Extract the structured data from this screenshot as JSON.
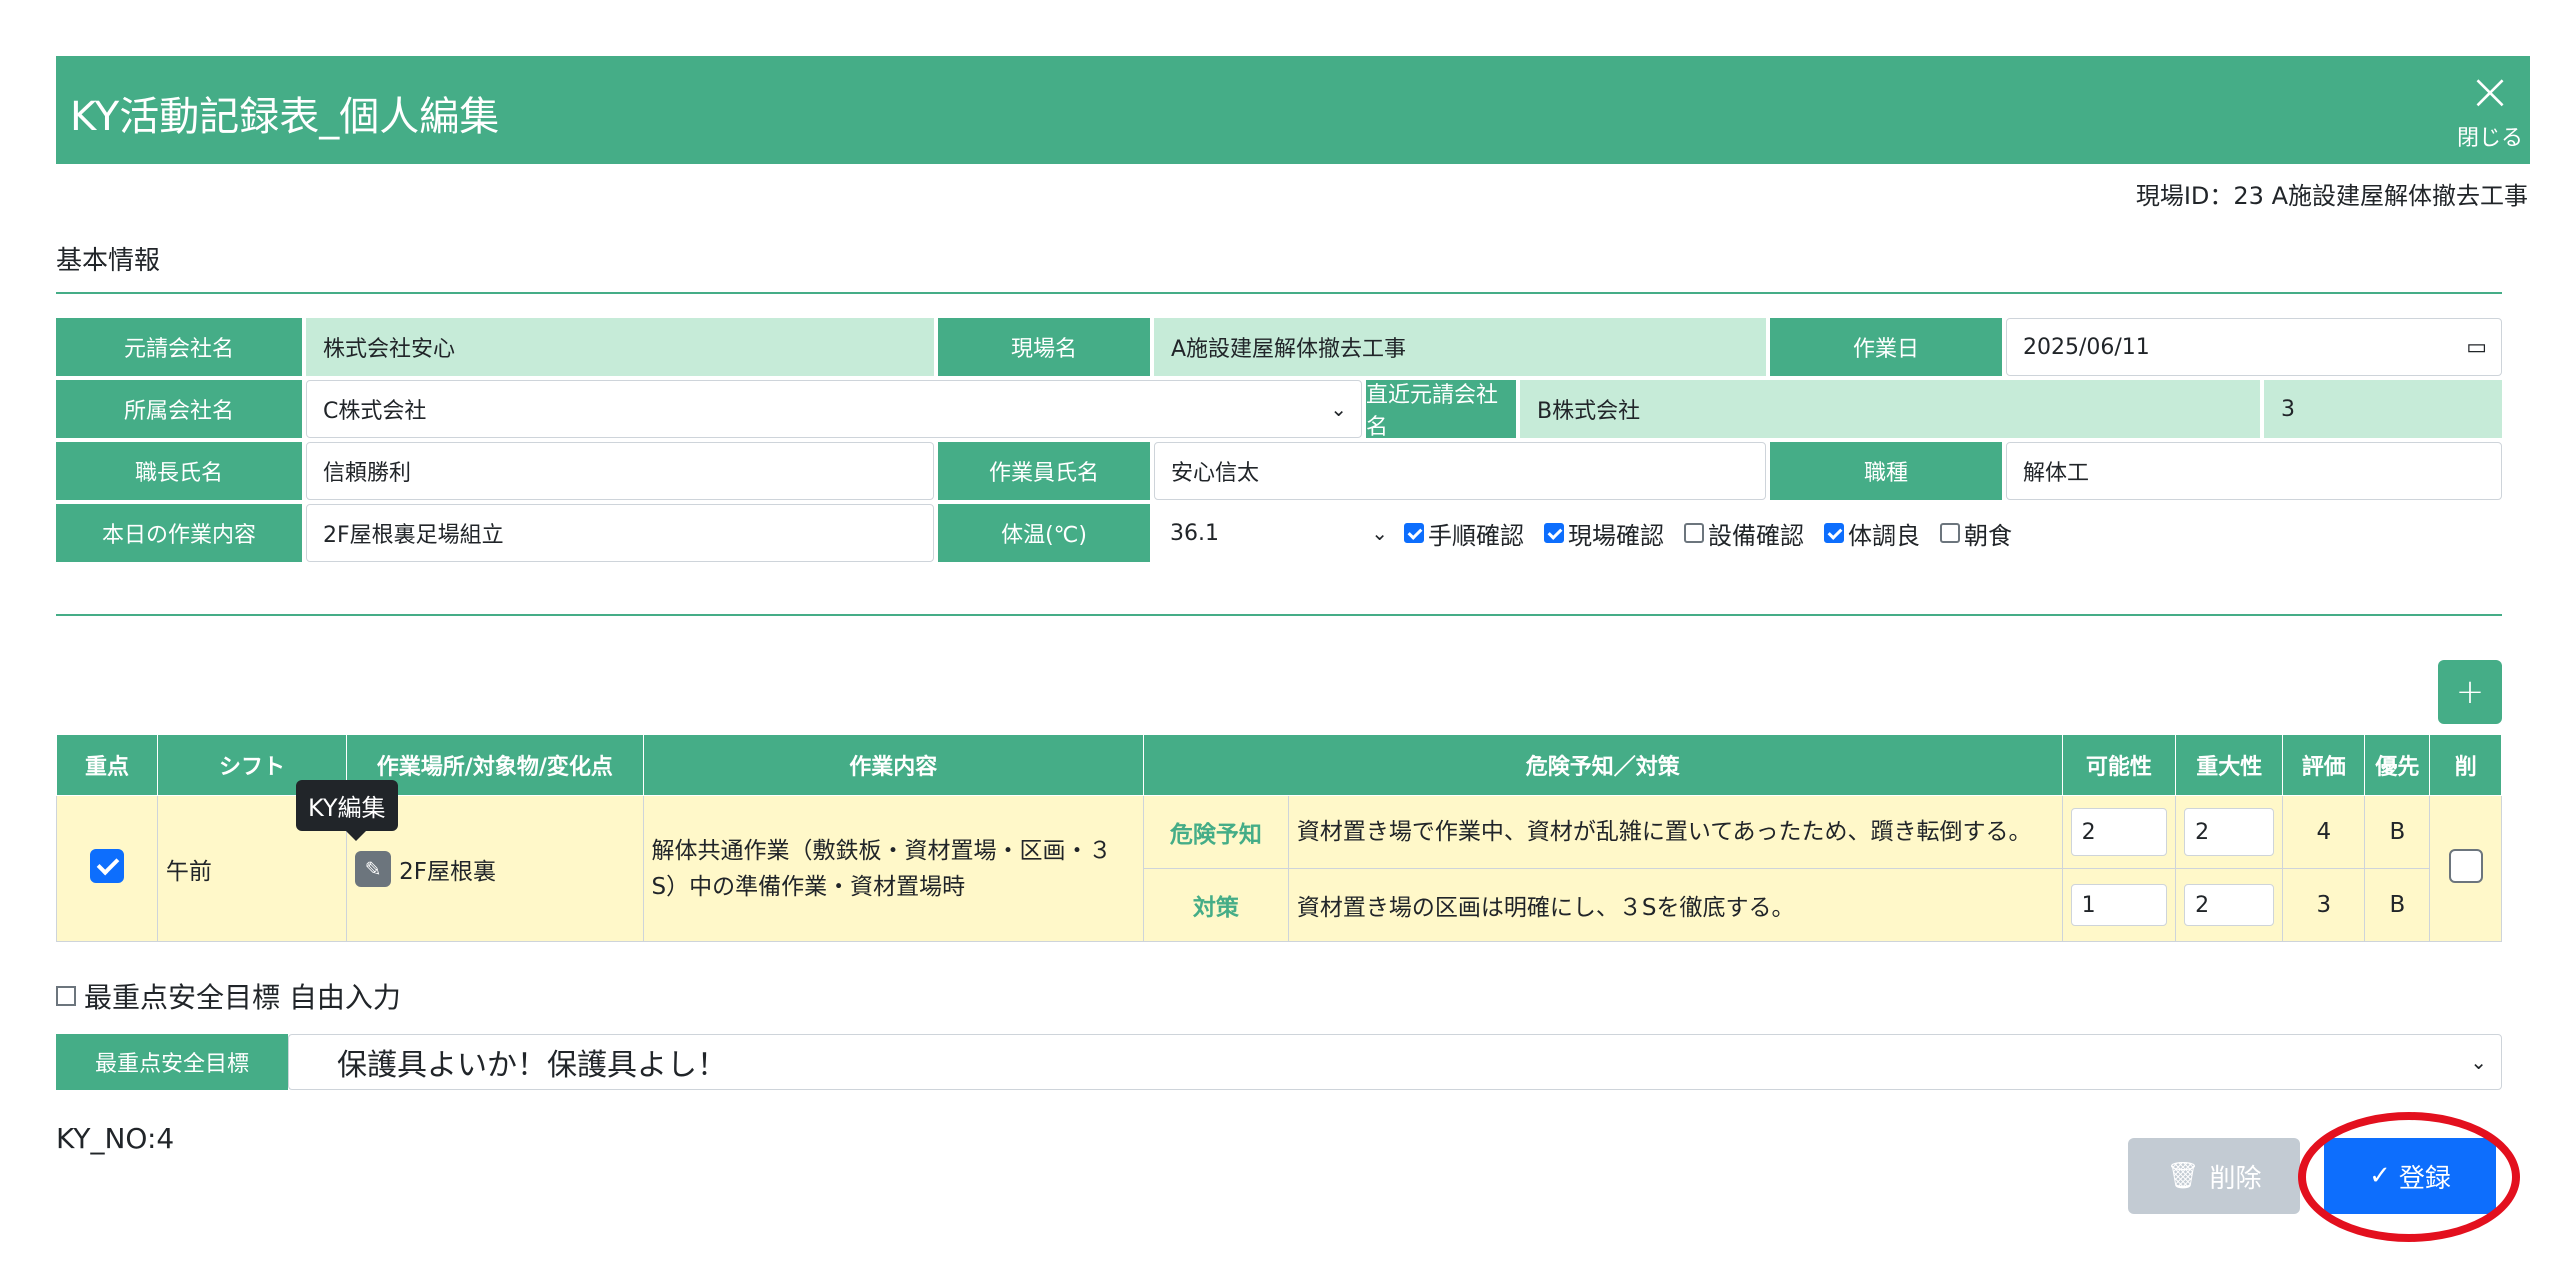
{
  "header": {
    "title": "KY活動記録表_個人編集",
    "close_label": "閉じる",
    "close_glyph": "×"
  },
  "site_id": "現場ID：23 A施設建屋解体撤去工事",
  "section": {
    "title": "基本情報"
  },
  "form": {
    "prime_company_label": "元請会社名",
    "prime_company_value": "株式会社安心",
    "site_name_label": "現場名",
    "site_name_value": "A施設建屋解体撤去工事",
    "work_date_label": "作業日",
    "work_date_value": "2025/06/11",
    "affiliation_label": "所属会社名",
    "affiliation_value": "C株式会社",
    "direct_prime_label": "直近元請会社名",
    "direct_prime_value": "B株式会社",
    "tier_value": "3",
    "foreman_label": "職長氏名",
    "foreman_value": "信頼勝利",
    "worker_label": "作業員氏名",
    "worker_value": "安心信太",
    "trade_label": "職種",
    "trade_value": "解体工",
    "today_work_label": "本日の作業内容",
    "today_work_value": "2F屋根裏足場組立",
    "temp_label": "体温(℃)",
    "temp_value": "36.1",
    "checks": [
      {
        "label": "手順確認",
        "checked": true
      },
      {
        "label": "現場確認",
        "checked": true
      },
      {
        "label": "設備確認",
        "checked": false
      },
      {
        "label": "体調良",
        "checked": true
      },
      {
        "label": "朝食",
        "checked": false
      }
    ]
  },
  "add_button": "+",
  "table": {
    "headers": [
      "重点",
      "シフト",
      "作業場所/対象物/変化点",
      "作業内容",
      "危険予知／対策",
      "可能性",
      "重大性",
      "評価",
      "優先",
      "削"
    ],
    "row": {
      "priority_checked": true,
      "shift": "午前",
      "location": "2F屋根裏",
      "work": "解体共通作業（敷鉄板・資材置場・区画・３S）中の準備作業・資材置場時",
      "hazard_tag": "危険予知",
      "hazard_text": "資材置き場で作業中、資材が乱雑に置いてあったため、躓き転倒する。",
      "hazard_possibility": "2",
      "hazard_severity": "2",
      "hazard_eval": "4",
      "hazard_priority": "B",
      "measure_tag": "対策",
      "measure_text": "資材置き場の区画は明確にし、３Sを徹底する。",
      "measure_possibility": "1",
      "measure_severity": "2",
      "measure_eval": "3",
      "measure_priority": "B"
    }
  },
  "tooltip": "KY編集",
  "free_input_label": "最重点安全目標 自由入力",
  "goal": {
    "label": "最重点安全目標",
    "value": "保護具よいか！保護具よし！"
  },
  "ky_no": "KY_NO:4",
  "buttons": {
    "delete": "削除",
    "register": "登録"
  },
  "colors": {
    "accent": "#45ad87",
    "primary": "#0d6efd",
    "highlight": "#e3101e",
    "row_bg": "#fff8c9"
  }
}
